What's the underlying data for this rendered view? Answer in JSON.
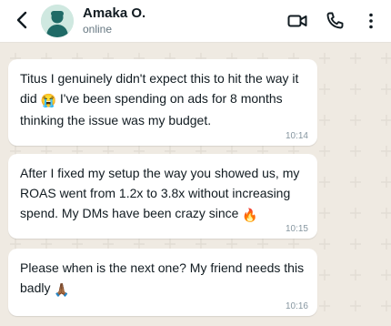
{
  "header": {
    "name": "Amaka O.",
    "status": "online",
    "icons": [
      "arrow-left-icon",
      "video-call-icon",
      "phone-icon",
      "more-vertical-icon"
    ]
  },
  "messages": [
    {
      "text_before": "Titus I genuinely didn't expect this to hit the way it did ",
      "emoji": "😭",
      "text_after": " I've been spending on ads for 8 months thinking the issue was my budget.",
      "time": "10:14"
    },
    {
      "text_before": "After I fixed my setup the way you showed us, my ROAS went from 1.2x to 3.8x without increasing spend. My DMs have been crazy since ",
      "emoji": "🔥",
      "text_after": "",
      "time": "10:15"
    },
    {
      "text_before": "Please when is the next one? My friend needs this badly ",
      "emoji": "🙏🏾",
      "text_after": "",
      "time": "10:16"
    }
  ],
  "colors": {
    "chat_background": "#efeae2",
    "header_background": "#ffffff",
    "bubble_incoming": "#ffffff",
    "text_primary": "#111b21",
    "text_secondary": "#667781"
  }
}
